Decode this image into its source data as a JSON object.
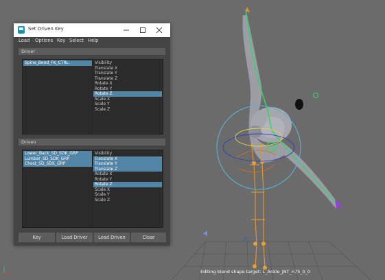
{
  "window": {
    "title": "Set Driven Key",
    "minimize_icon": "minimize-icon",
    "maximize_icon": "maximize-icon",
    "close_icon": "close-icon"
  },
  "menubar": [
    "Load",
    "Options",
    "Key",
    "Select",
    "Help"
  ],
  "driver": {
    "header": "Driver",
    "objects": [
      {
        "label": "Spine_Bend_FK_CTRL",
        "selected": true
      }
    ],
    "attributes": [
      {
        "label": "Visibility",
        "selected": false
      },
      {
        "label": "Translate X",
        "selected": false
      },
      {
        "label": "Translate Y",
        "selected": false
      },
      {
        "label": "Translate Z",
        "selected": false
      },
      {
        "label": "Rotate X",
        "selected": false
      },
      {
        "label": "Rotate Y",
        "selected": false
      },
      {
        "label": "Rotate Z",
        "selected": true
      },
      {
        "label": "Scale X",
        "selected": false
      },
      {
        "label": "Scale Y",
        "selected": false
      },
      {
        "label": "Scale Z",
        "selected": false
      }
    ]
  },
  "driven": {
    "header": "Driven",
    "objects": [
      {
        "label": "Lower_Back_SD_SDK_GRP",
        "selected": true
      },
      {
        "label": "Lumbar_SD_SDK_GRP",
        "selected": true
      },
      {
        "label": "Chest_SD_SDK_GRP",
        "selected": true
      }
    ],
    "attributes": [
      {
        "label": "Visibility",
        "selected": false
      },
      {
        "label": "Translate X",
        "selected": true
      },
      {
        "label": "Translate Y",
        "selected": true
      },
      {
        "label": "Translate Z",
        "selected": true
      },
      {
        "label": "Rotate X",
        "selected": false
      },
      {
        "label": "Rotate Y",
        "selected": false
      },
      {
        "label": "Rotate Z",
        "selected": true
      },
      {
        "label": "Scale X",
        "selected": false
      },
      {
        "label": "Scale Y",
        "selected": false
      },
      {
        "label": "Scale Z",
        "selected": false
      }
    ]
  },
  "buttons": {
    "key": "Key",
    "load_driver": "Load Driver",
    "load_driven": "Load Driven",
    "close": "Close"
  },
  "viewport": {
    "status_text": "Editing blend shape target: L_Ankle_JNT_n75_0_0"
  },
  "colors": {
    "selection": "#5285a6",
    "panel_bg": "#444444",
    "list_bg": "#2b2b2b",
    "viewport_bg": "#6b6b6b"
  }
}
